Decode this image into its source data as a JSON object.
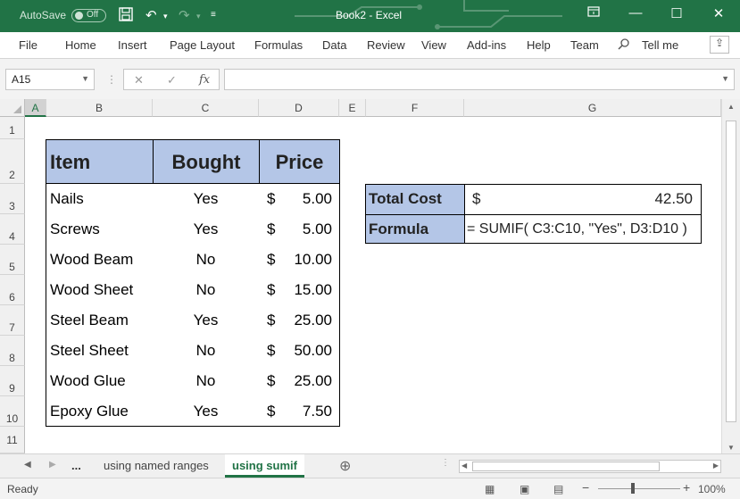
{
  "titlebar": {
    "autosave_label": "AutoSave",
    "autosave_state": "Off",
    "title": "Book2  -  Excel",
    "icons": [
      "save-icon",
      "undo-icon",
      "redo-icon",
      "customize-qat-icon",
      "ribbon-display-icon",
      "minimize-icon",
      "maximize-icon",
      "close-icon"
    ]
  },
  "ribbon": {
    "tabs": [
      "File",
      "Home",
      "Insert",
      "Page Layout",
      "Formulas",
      "Data",
      "Review",
      "View",
      "Add-ins",
      "Help",
      "Team"
    ],
    "tell_me": "Tell me"
  },
  "formula_bar": {
    "name_box": "A15",
    "fx": "fx",
    "formula": ""
  },
  "columns": [
    "A",
    "B",
    "C",
    "D",
    "E",
    "F",
    "G"
  ],
  "rows": [
    "1",
    "2",
    "3",
    "4",
    "5",
    "6",
    "7",
    "8",
    "9",
    "10",
    "11"
  ],
  "table": {
    "headers": [
      "Item",
      "Bought",
      "Price"
    ],
    "rows": [
      {
        "item": "Nails",
        "bought": "Yes",
        "cur": "$",
        "price": "5.00"
      },
      {
        "item": "Screws",
        "bought": "Yes",
        "cur": "$",
        "price": "5.00"
      },
      {
        "item": "Wood Beam",
        "bought": "No",
        "cur": "$",
        "price": "10.00"
      },
      {
        "item": "Wood Sheet",
        "bought": "No",
        "cur": "$",
        "price": "15.00"
      },
      {
        "item": "Steel Beam",
        "bought": "Yes",
        "cur": "$",
        "price": "25.00"
      },
      {
        "item": "Steel Sheet",
        "bought": "No",
        "cur": "$",
        "price": "50.00"
      },
      {
        "item": "Wood Glue",
        "bought": "No",
        "cur": "$",
        "price": "25.00"
      },
      {
        "item": "Epoxy Glue",
        "bought": "Yes",
        "cur": "$",
        "price": "7.50"
      }
    ]
  },
  "summary": {
    "total_label": "Total Cost",
    "total_cur": "$",
    "total_value": "42.50",
    "formula_label": "Formula",
    "formula_value": "= SUMIF( C3:C10, \"Yes\", D3:D10 )"
  },
  "sheets": {
    "ellipsis": "...",
    "tabs": [
      "using named ranges",
      "using sumif"
    ],
    "active": "using sumif"
  },
  "status": {
    "ready": "Ready",
    "zoom": "100%"
  },
  "colors": {
    "excel_green": "#217346",
    "header_fill": "#b4c6e7"
  }
}
